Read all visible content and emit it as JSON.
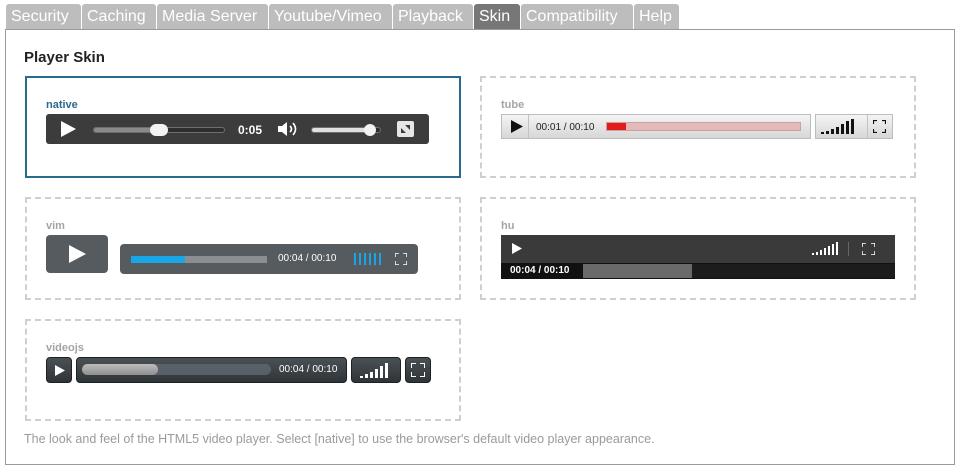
{
  "tabs": [
    {
      "label": "Security"
    },
    {
      "label": "Caching"
    },
    {
      "label": "Media Server"
    },
    {
      "label": "Youtube/Vimeo"
    },
    {
      "label": "Playback"
    },
    {
      "label": "Skin",
      "active": true
    },
    {
      "label": "Compatibility"
    },
    {
      "label": "Help"
    }
  ],
  "panel": {
    "heading": "Player Skin",
    "help_text": "The look and feel of the HTML5 video player. Select [native] to use the browser's default video player appearance."
  },
  "skins": {
    "native": {
      "label": "native",
      "selected": true,
      "time": "0:05",
      "progress": 0.5,
      "volume": 0.85
    },
    "tube": {
      "label": "tube",
      "time": "00:01 / 00:10",
      "progress": 0.1
    },
    "vim": {
      "label": "vim",
      "time": "00:04 / 00:10",
      "progress": 0.4
    },
    "hu": {
      "label": "hu",
      "time": "00:04 / 00:10",
      "progress": 0.35
    },
    "videojs": {
      "label": "videojs",
      "time": "00:04 / 00:10",
      "progress": 0.4
    }
  },
  "colors": {
    "selected_border": "#2a6a8e",
    "tab_active": "#777777",
    "tab_inactive": "#bdbdbd",
    "tube_progress": "#e21b1b",
    "vim_progress": "#19a6e6"
  },
  "icons": {
    "play": "play-icon",
    "volume": "volume-icon",
    "fullscreen": "fullscreen-icon",
    "signal": "volume-bars-icon"
  }
}
